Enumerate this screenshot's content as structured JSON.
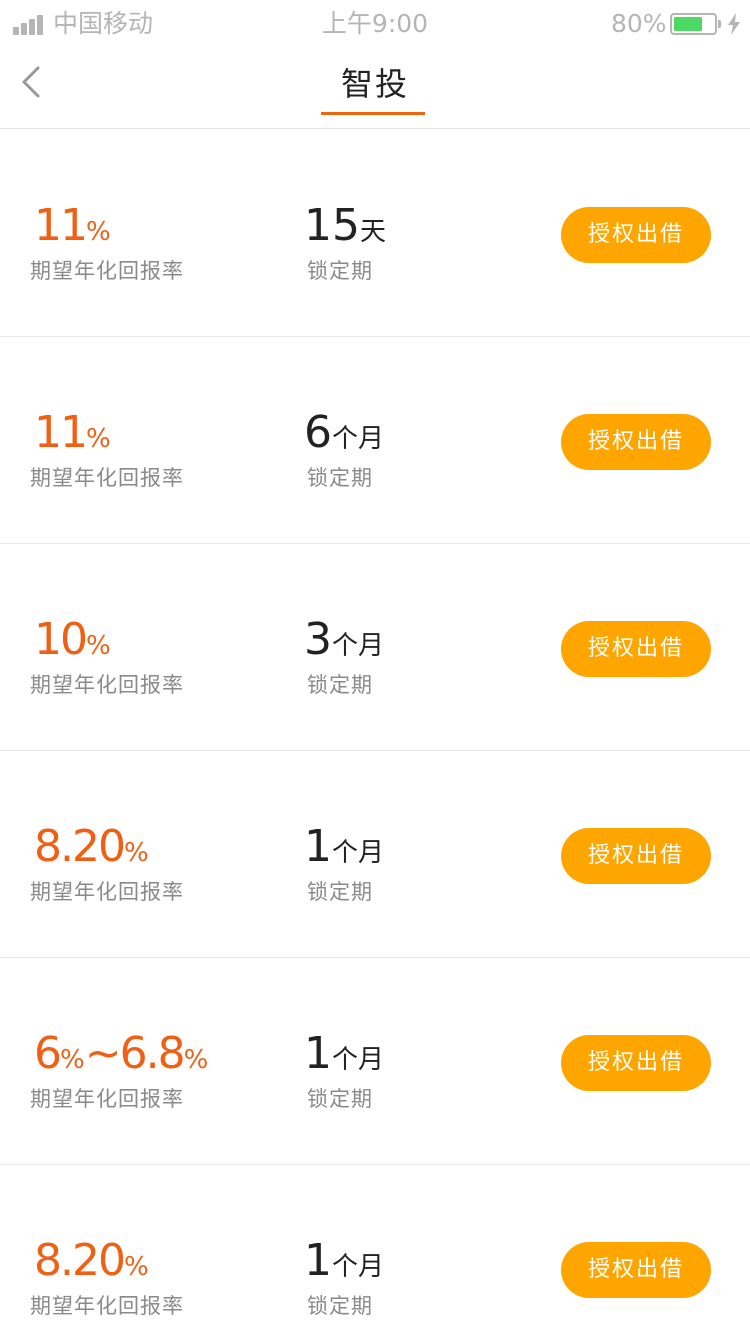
{
  "status_bar": {
    "carrier": "中国移动",
    "time": "上午9:00",
    "battery_percent": "80%",
    "battery_level": 0.8,
    "battery_color": "#4cd964"
  },
  "nav": {
    "title": "智投",
    "back_icon": "chevron-left-icon",
    "accent_color": "#ee6411"
  },
  "colors": {
    "rate": "#f06014",
    "button": "#ffa500"
  },
  "products": [
    {
      "rate_value": "11",
      "rate_unit": "%",
      "rate_label": "期望年化回报率",
      "term_value": "15",
      "term_unit": "天",
      "term_label": "锁定期",
      "button_label": "授权出借"
    },
    {
      "rate_value": "11",
      "rate_unit": "%",
      "rate_label": "期望年化回报率",
      "term_value": "6",
      "term_unit": "个月",
      "term_label": "锁定期",
      "button_label": "授权出借"
    },
    {
      "rate_value": "10",
      "rate_unit": "%",
      "rate_label": "期望年化回报率",
      "term_value": "3",
      "term_unit": "个月",
      "term_label": "锁定期",
      "button_label": "授权出借"
    },
    {
      "rate_value": "8.20",
      "rate_unit": "%",
      "rate_label": "期望年化回报率",
      "term_value": "1",
      "term_unit": "个月",
      "term_label": "锁定期",
      "button_label": "授权出借"
    },
    {
      "rate_value": "6",
      "rate_unit": "%",
      "rate_extra": "~6.8",
      "rate_extra_unit": "%",
      "rate_label": "期望年化回报率",
      "term_value": "1",
      "term_unit": "个月",
      "term_label": "锁定期",
      "button_label": "授权出借"
    },
    {
      "rate_value": "8.20",
      "rate_unit": "%",
      "rate_label": "期望年化回报率",
      "term_value": "1",
      "term_unit": "个月",
      "term_label": "锁定期",
      "button_label": "授权出借"
    }
  ]
}
